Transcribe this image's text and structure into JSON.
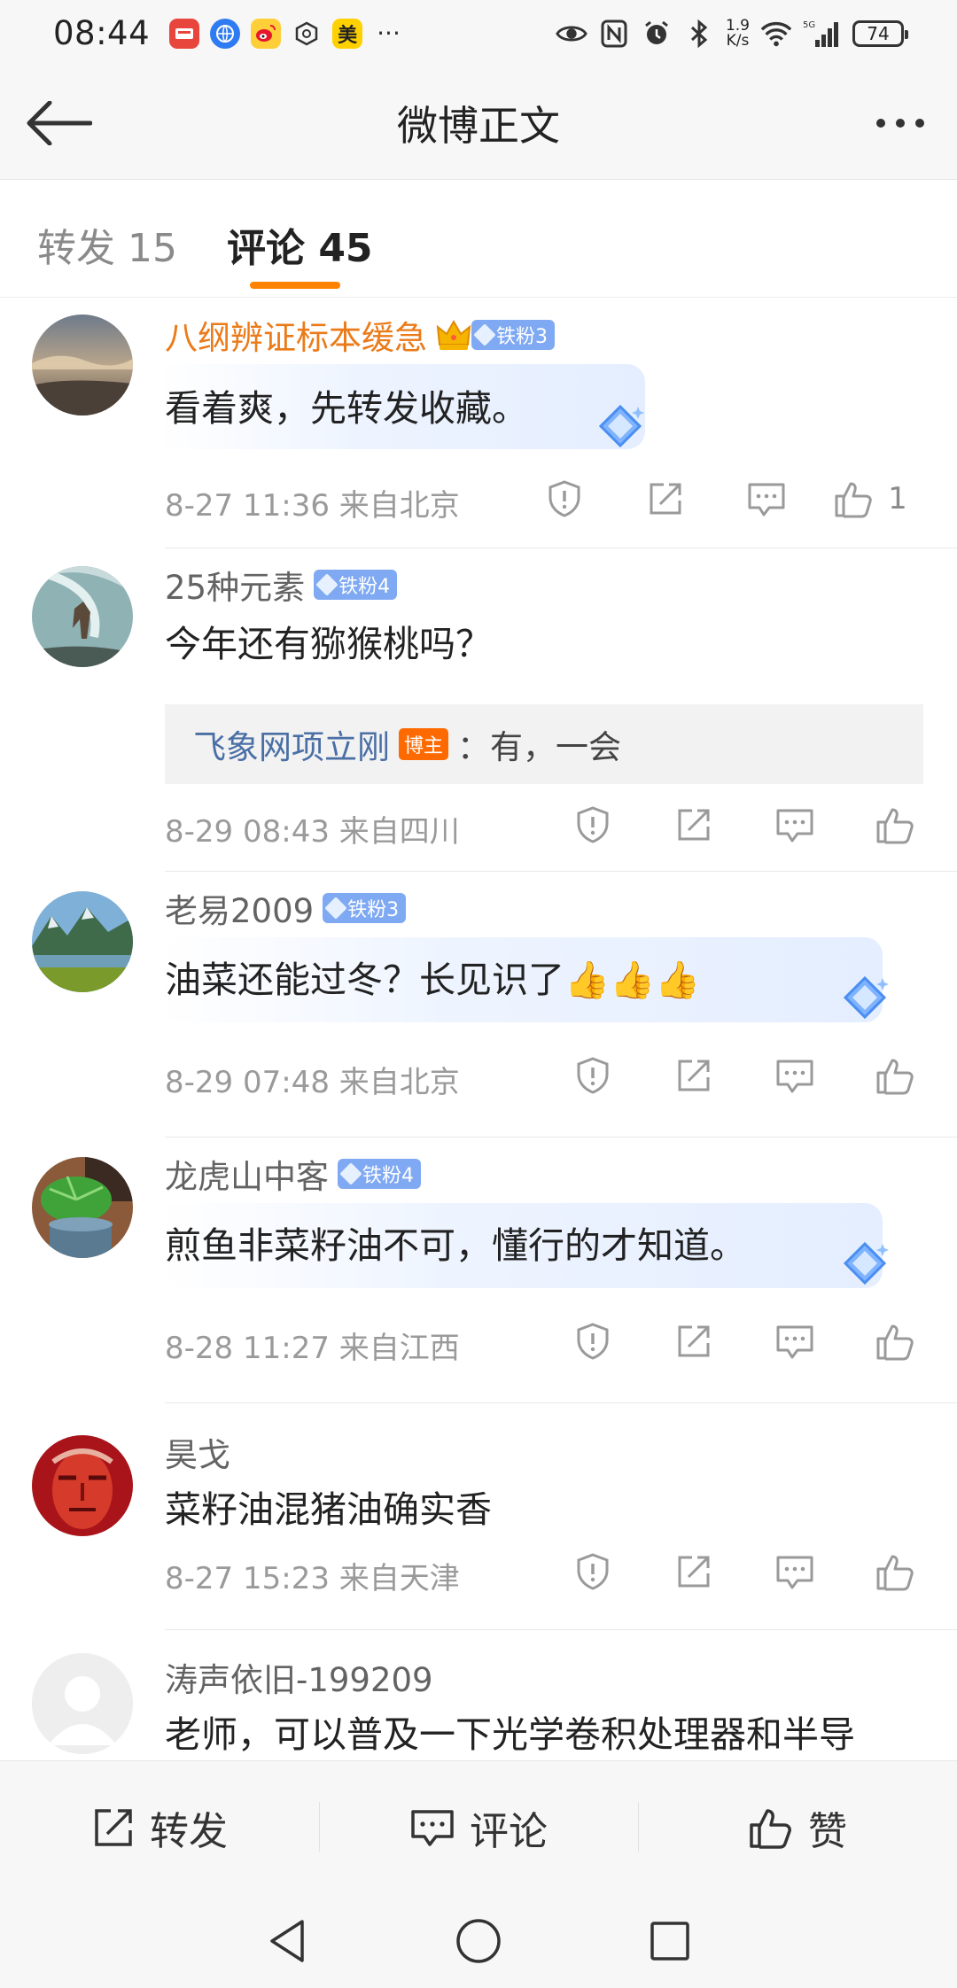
{
  "status_bar": {
    "time": "08:44",
    "speed_top": "1.9",
    "speed_bottom": "K/s",
    "signal_label": "5G",
    "battery": "74",
    "more": "···",
    "app_icons": [
      "app-red-icon",
      "browser-icon",
      "weibo-icon",
      "hexagon-icon",
      "meituan-icon"
    ],
    "meituan_label": "美"
  },
  "header": {
    "title": "微博正文"
  },
  "tabs": {
    "repost": "转发 15",
    "comment": "评论 45"
  },
  "comments": [
    {
      "name": "八纲辨证标本缓急",
      "badge": "铁粉3",
      "vip": true,
      "text": "看着爽，先转发收藏。",
      "meta": "8-27 11:36  来自北京",
      "likes": "1"
    },
    {
      "name": "25种元素",
      "badge": "铁粉4",
      "text": "今年还有猕猴桃吗？",
      "reply_name": "飞象网项立刚",
      "reply_badge": "博主",
      "reply_text": "：有，一会",
      "meta": "8-29 08:43  来自四川"
    },
    {
      "name": "老易2009",
      "badge": "铁粉3",
      "text": "油菜还能过冬？长见识了👍👍👍",
      "meta": "8-29 07:48  来自北京"
    },
    {
      "name": "龙虎山中客",
      "badge": "铁粉4",
      "text": "煎鱼非菜籽油不可，懂行的才知道。",
      "meta": "8-28 11:27  来自江西"
    },
    {
      "name": "昊戈",
      "text": "菜籽油混猪油确实香",
      "meta": "8-27 15:23  来自天津"
    },
    {
      "name": "涛声依旧-199209",
      "text": "老师，可以普及一下光学卷积处理器和半导"
    }
  ],
  "bottom_bar": {
    "repost": "转发",
    "comment": "评论",
    "like": "赞"
  },
  "colors": {
    "accent": "#ff8200",
    "vip_name": "#eb7a19",
    "fan_badge": "#7fa9f2",
    "reply_name": "#4a6fa5",
    "host_badge": "#ff6a00"
  }
}
